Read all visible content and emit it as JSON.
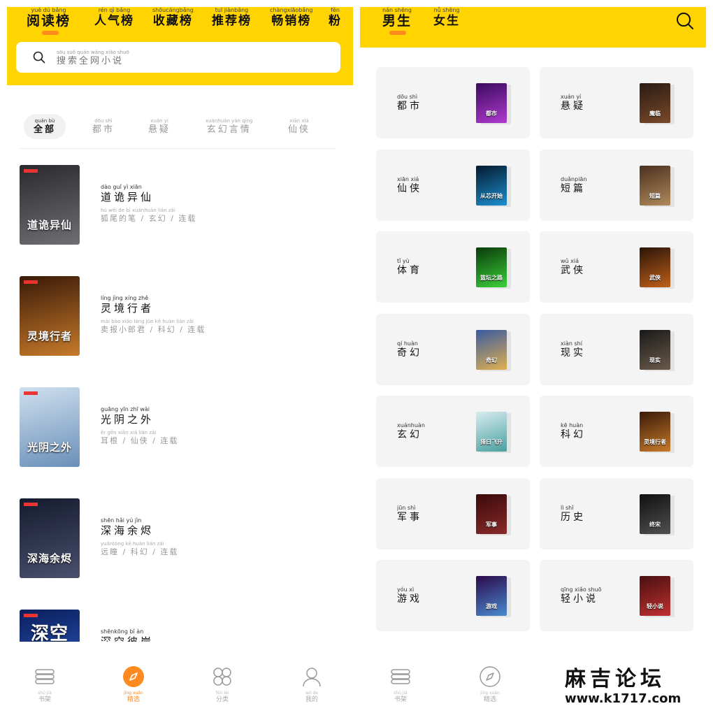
{
  "left": {
    "top_tabs": [
      {
        "py": "yuè dú bǎng",
        "label": "阅读榜",
        "active": true
      },
      {
        "py": "rén qì bǎng",
        "label": "人气榜"
      },
      {
        "py": "shōucángbǎng",
        "label": "收藏榜"
      },
      {
        "py": "tuī jiànbǎng",
        "label": "推荐榜"
      },
      {
        "py": "chàngxiāobǎng",
        "label": "畅销榜"
      },
      {
        "py": "fěn",
        "label": "粉"
      }
    ],
    "search": {
      "py": "sōu suǒ quán wǎng xiǎo shuō",
      "placeholder": "搜索全网小说"
    },
    "categories": [
      {
        "py": "quán bù",
        "label": "全部",
        "active": true
      },
      {
        "py": "dōu shì",
        "label": "都市"
      },
      {
        "py": "xuán yí",
        "label": "悬疑"
      },
      {
        "py": "xuánhuàn yán qíng",
        "label": "玄幻言情"
      },
      {
        "py": "xiān xiá",
        "label": "仙侠"
      }
    ],
    "books": [
      {
        "title_py": "dào guǐ yì xiān",
        "title": "道诡异仙",
        "meta_py": "hú wěi de bǐ   xuánhuàn   lián zǎi",
        "meta": "狐尾的笔 / 玄幻 / 连载",
        "cover_text": "道诡异仙",
        "c1": "#2a2a2e",
        "c2": "#6e6e74"
      },
      {
        "title_py": "líng jìng xíng zhě",
        "title": "灵境行者",
        "meta_py": "mài bào xiǎo láng jūn   kē huàn   lián zǎi",
        "meta": "卖报小郎君 / 科幻 / 连载",
        "cover_text": "灵境行者",
        "c1": "#3a1a08",
        "c2": "#c77a2a"
      },
      {
        "title_py": "guāng yīn zhī wài",
        "title": "光阴之外",
        "meta_py": "ěr gēn   xiān xiá   lián zǎi",
        "meta": "耳根 / 仙侠 / 连载",
        "cover_text": "光阴之外",
        "c1": "#cfe0ef",
        "c2": "#6a8fb8"
      },
      {
        "title_py": "shēn hǎi yú jìn",
        "title": "深海余烬",
        "meta_py": "yuǎntóng   kē huàn   lián zǎi",
        "meta": "远瞳 / 科幻 / 连载",
        "cover_text": "深海余烬",
        "c1": "#151b2e",
        "c2": "#4a4f6e"
      },
      {
        "title_py": "shēnkōng bǐ àn",
        "title": "深空彼岸",
        "meta_py": "",
        "meta": "",
        "cover_text": "深空",
        "c1": "#0b1f5a",
        "c2": "#2f5fd0"
      }
    ],
    "nav": [
      {
        "py": "shū jià",
        "label": "书架",
        "icon": "bookshelf-icon"
      },
      {
        "py": "jīng xuǎn",
        "label": "精选",
        "icon": "compass-icon",
        "active": true
      },
      {
        "py": "fēn lèi",
        "label": "分类",
        "icon": "category-icon"
      },
      {
        "py": "wǒ de",
        "label": "我的",
        "icon": "user-icon"
      }
    ]
  },
  "right": {
    "top_tabs": [
      {
        "py": "nán shēng",
        "label": "男生",
        "active": true
      },
      {
        "py": "nǚ shēng",
        "label": "女生"
      }
    ],
    "genres": [
      {
        "py": "dōu shì",
        "label": "都市",
        "cover": "都市",
        "c1": "#3b0b5e",
        "c2": "#b03ad0"
      },
      {
        "py": "xuán yí",
        "label": "悬疑",
        "cover": "魔临",
        "c1": "#2a1a12",
        "c2": "#7a4a2a"
      },
      {
        "py": "xiān xiá",
        "label": "仙侠",
        "cover": "从芯开始",
        "c1": "#041a2e",
        "c2": "#1d8fd0"
      },
      {
        "py": "duǎnpiān",
        "label": "短篇",
        "cover": "短篇",
        "c1": "#4a3020",
        "c2": "#b08a5a"
      },
      {
        "py": "tǐ yù",
        "label": "体育",
        "cover": "篮坛之路",
        "c1": "#0a3a0a",
        "c2": "#3ad03a"
      },
      {
        "py": "wǔ xiá",
        "label": "武侠",
        "cover": "武侠",
        "c1": "#2a1408",
        "c2": "#c0601a"
      },
      {
        "py": "qí huàn",
        "label": "奇幻",
        "cover": "奇幻",
        "c1": "#3a5aa0",
        "c2": "#e0b050"
      },
      {
        "py": "xiàn shí",
        "label": "现实",
        "cover": "现实",
        "c1": "#1a1a1a",
        "c2": "#6a5a4a"
      },
      {
        "py": "xuánhuàn",
        "label": "玄幻",
        "cover": "择日飞升",
        "c1": "#d8ecf0",
        "c2": "#4aa0a0"
      },
      {
        "py": "kē huàn",
        "label": "科幻",
        "cover": "灵境行者",
        "c1": "#3a1a08",
        "c2": "#c77a2a"
      },
      {
        "py": "jūn shì",
        "label": "军事",
        "cover": "军事",
        "c1": "#3a0a0a",
        "c2": "#8a2a2a"
      },
      {
        "py": "lì shǐ",
        "label": "历史",
        "cover": "终宋",
        "c1": "#101010",
        "c2": "#505050"
      },
      {
        "py": "yóu xì",
        "label": "游戏",
        "cover": "游戏",
        "c1": "#2a0a4a",
        "c2": "#4a8ad0"
      },
      {
        "py": "qīng xiǎo shuō",
        "label": "轻小说",
        "cover": "轻小说",
        "c1": "#4a1010",
        "c2": "#c03030"
      }
    ],
    "nav": [
      {
        "py": "shū jià",
        "label": "书架",
        "icon": "bookshelf-icon"
      },
      {
        "py": "jīng xuǎn",
        "label": "精选",
        "icon": "compass-icon"
      }
    ]
  },
  "watermark": {
    "line1": "麻吉论坛",
    "line2": "www.k1717.com"
  },
  "colors": {
    "brand_yellow": "#ffd400",
    "accent_orange": "#ff8a1f"
  }
}
